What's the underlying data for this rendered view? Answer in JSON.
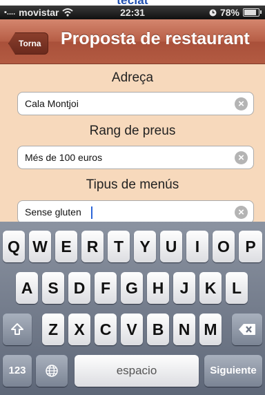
{
  "caption": "teclat",
  "status_bar": {
    "signal": "▪....",
    "carrier": "movistar",
    "time": "22:31",
    "battery": "78%",
    "battery_level": 0.78
  },
  "nav": {
    "back_label": "Torna",
    "title": "Proposta de restaurant"
  },
  "form": {
    "address_label": "Adreça",
    "address_value": "Cala Montjoi",
    "price_label": "Rang de preus",
    "price_value": "Més de 100 euros",
    "menu_label": "Tipus de menús",
    "menu_value": "Sense gluten"
  },
  "keyboard": {
    "row1": [
      "Q",
      "W",
      "E",
      "R",
      "T",
      "Y",
      "U",
      "I",
      "O",
      "P"
    ],
    "row2": [
      "A",
      "S",
      "D",
      "F",
      "G",
      "H",
      "J",
      "K",
      "L"
    ],
    "row3": [
      "Z",
      "X",
      "C",
      "V",
      "B",
      "N",
      "M"
    ],
    "numbers_label": "123",
    "space_label": "espacio",
    "next_label": "Siguiente"
  },
  "colors": {
    "nav": "#b65d45",
    "form_bg": "#f7d9bc",
    "caption": "#1f4fb0"
  }
}
